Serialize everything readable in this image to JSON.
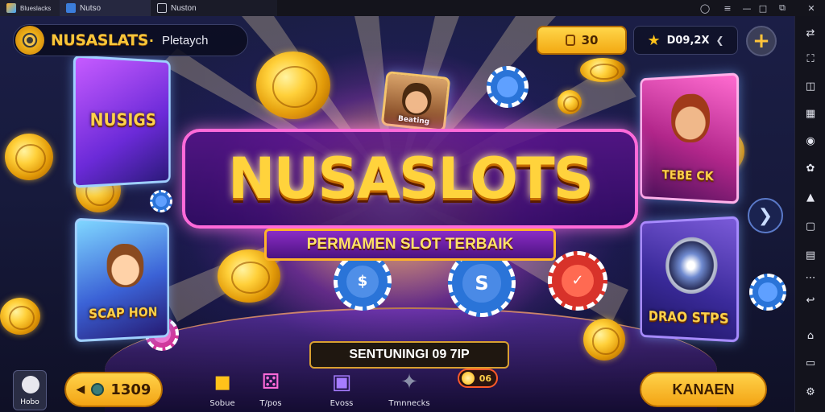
{
  "window": {
    "tabs": [
      {
        "label": "Blueslacks"
      },
      {
        "label": "Nutso"
      },
      {
        "label": "Nuston"
      }
    ]
  },
  "header": {
    "logo_name": "NUSASLATS",
    "logo_suffix": "·",
    "subtitle": "Pletaych",
    "coins_value": "30",
    "balance_value": "D09,2X"
  },
  "cards": {
    "left_top": "NUSIGS",
    "left_bottom": "SCAP HON",
    "mid_top": "Beating",
    "right_top": "TEBE CK",
    "right_bottom": "DRAO STPS"
  },
  "hero": {
    "title": "NUSASLOTS",
    "subtitle": "PERMAMEN SLOT TERBAIK"
  },
  "ticker": "SENTUNINGI 09 7IP",
  "bottom": {
    "home_label": "Hobo",
    "left_button": "1309",
    "right_button": "KANAEN",
    "badge": "06",
    "nav": [
      {
        "label": "Sobue",
        "icon": "lucky-box-icon"
      },
      {
        "label": "T/pos",
        "icon": "dice-icon"
      },
      {
        "label": "Evoss",
        "icon": "slot-machine-icon"
      },
      {
        "label": "Tmnnecks",
        "icon": "star-icon"
      }
    ]
  },
  "colors": {
    "gold": "#ffd33c",
    "magenta": "#ff6ad9",
    "purple": "#4c1380"
  }
}
